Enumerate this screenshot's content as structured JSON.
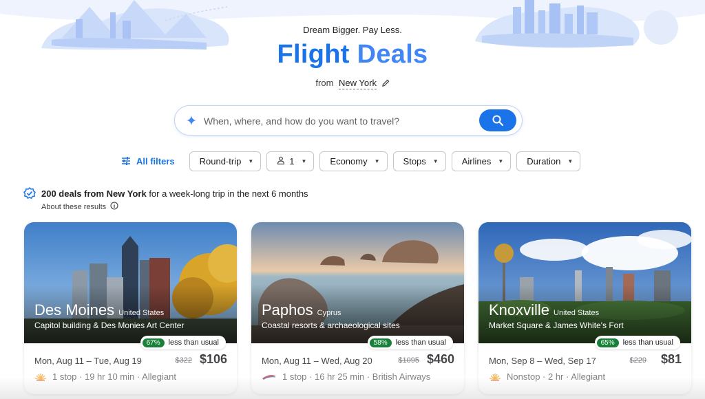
{
  "hero": {
    "tagline": "Dream Bigger. Pay Less.",
    "title_part1": "Flight",
    "title_part2": "Deals",
    "from_label": "from",
    "from_city": "New York"
  },
  "search": {
    "placeholder": "When, where, and how do you want to travel?"
  },
  "filters": {
    "all_filters": "All filters",
    "trip_type": "Round-trip",
    "passengers": "1",
    "cabin": "Economy",
    "stops": "Stops",
    "airlines": "Airlines",
    "duration": "Duration"
  },
  "summary": {
    "count_text": "200 deals from New York",
    "rest_text": " for a week-long trip in the next 6 months",
    "about": "About these results"
  },
  "cards": [
    {
      "city": "Des Moines",
      "country": "United States",
      "description": "Capitol building & Des Monies Art Center",
      "percent": "67%",
      "deal_text": "less than usual",
      "dates": "Mon, Aug 11 – Tue, Aug 19",
      "old_price": "$322",
      "price": "$106",
      "flight_info": "1 stop · 19 hr 10 min · Allegiant",
      "airline_icon": "allegiant-icon"
    },
    {
      "city": "Paphos",
      "country": "Cyprus",
      "description": "Coastal resorts & archaeological sites",
      "percent": "58%",
      "deal_text": "less than usual",
      "dates": "Mon, Aug 11 – Wed, Aug 20",
      "old_price": "$1095",
      "price": "$460",
      "flight_info": "1 stop · 16 hr 25 min · British Airways",
      "airline_icon": "british-airways-icon"
    },
    {
      "city": "Knoxville",
      "country": "United States",
      "description": "Market Square & James White's Fort",
      "percent": "65%",
      "deal_text": "less than usual",
      "dates": "Mon, Sep 8 – Wed, Sep 17",
      "old_price": "$229",
      "price": "$81",
      "flight_info": "Nonstop · 2 hr · Allegiant",
      "airline_icon": "allegiant-icon"
    }
  ],
  "colors": {
    "accent": "#1a73e8",
    "deal_badge": "#188038"
  }
}
